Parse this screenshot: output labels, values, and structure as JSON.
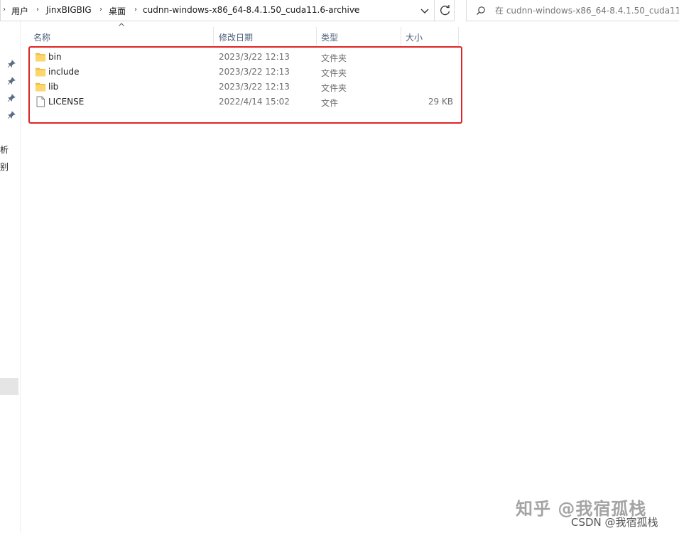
{
  "address_bar": {
    "crumbs": [
      "用户",
      "JinxBIGBIG",
      "桌面",
      "cudnn-windows-x86_64-8.4.1.50_cuda11.6-archive"
    ]
  },
  "search": {
    "placeholder": "在 cudnn-windows-x86_64-8.4.1.50_cuda11.6-"
  },
  "nav": {
    "partial_labels": [
      "析",
      "别"
    ]
  },
  "columns": {
    "name": "名称",
    "date": "修改日期",
    "type": "类型",
    "size": "大小"
  },
  "files": [
    {
      "name": "bin",
      "date": "2023/3/22 12:13",
      "type": "文件夹",
      "size": "",
      "icon": "folder-icon"
    },
    {
      "name": "include",
      "date": "2023/3/22 12:13",
      "type": "文件夹",
      "size": "",
      "icon": "folder-icon"
    },
    {
      "name": "lib",
      "date": "2023/3/22 12:13",
      "type": "文件夹",
      "size": "",
      "icon": "folder-icon"
    },
    {
      "name": "LICENSE",
      "date": "2022/4/14 15:02",
      "type": "文件",
      "size": "29 KB",
      "icon": "file-icon"
    }
  ],
  "highlight_color": "#e02424",
  "watermark": {
    "main": "知乎 @我宿孤栈",
    "sub": "CSDN @我宿孤栈"
  }
}
